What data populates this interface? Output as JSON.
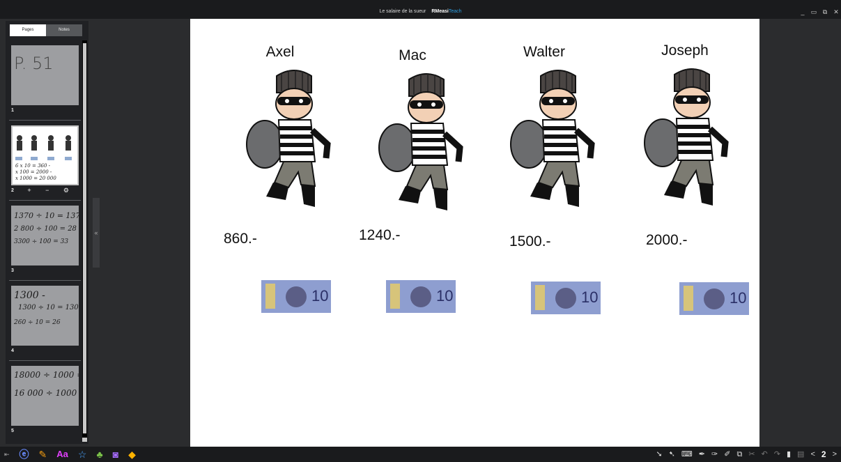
{
  "window": {
    "title": "Le salaire de la sueur",
    "brand_main": "RMeasi",
    "brand_accent": "Teach",
    "controls": [
      "_",
      "▭",
      "⧉",
      "✕"
    ]
  },
  "sidebar": {
    "tabs": [
      "Pages",
      "Notes"
    ],
    "pages": [
      {
        "number": "1",
        "handwriting": [
          "P. 51"
        ]
      },
      {
        "number": "2",
        "handwriting": [
          "6 x 10 = 360 -",
          "x 100 = 2000 -",
          "x 1000 = 20 000"
        ],
        "controls": "+ − ⚙"
      },
      {
        "number": "3",
        "handwriting": [
          "1370 ÷ 10 = 137",
          "2 800 ÷ 100 = 28",
          "3300 ÷ 100 = 33"
        ]
      },
      {
        "number": "4",
        "handwriting": [
          "1300 -",
          "1300 ÷ 10 = 130",
          "260 ÷ 10 = 26"
        ]
      },
      {
        "number": "5",
        "handwriting": [
          "18000 ÷ 1000 = 18",
          "16 000 ÷ 1000 = 16"
        ]
      }
    ]
  },
  "slide": {
    "thieves": [
      {
        "name": "Axel",
        "price": "860.-"
      },
      {
        "name": "Mac",
        "price": "1240.-"
      },
      {
        "name": "Walter",
        "price": "1500.-"
      },
      {
        "name": "Joseph",
        "price": "2000.-"
      }
    ],
    "banknote_value": "10"
  },
  "taskbar": {
    "left_icons": [
      "collapse-icon",
      "browser-icon",
      "pen-icon",
      "text-icon",
      "star-tool-icon",
      "tree-icon",
      "camera-icon",
      "fill-icon"
    ],
    "text_tool_label": "Aa",
    "right_icons": [
      "select-icon",
      "multi-select-icon",
      "keyboard-icon",
      "pen-tool-icon",
      "highlighter-icon",
      "eraser-icon",
      "copy-icon",
      "cut-icon",
      "undo-icon",
      "redo-icon",
      "lock-icon",
      "page-icon"
    ],
    "page_number": "2"
  }
}
